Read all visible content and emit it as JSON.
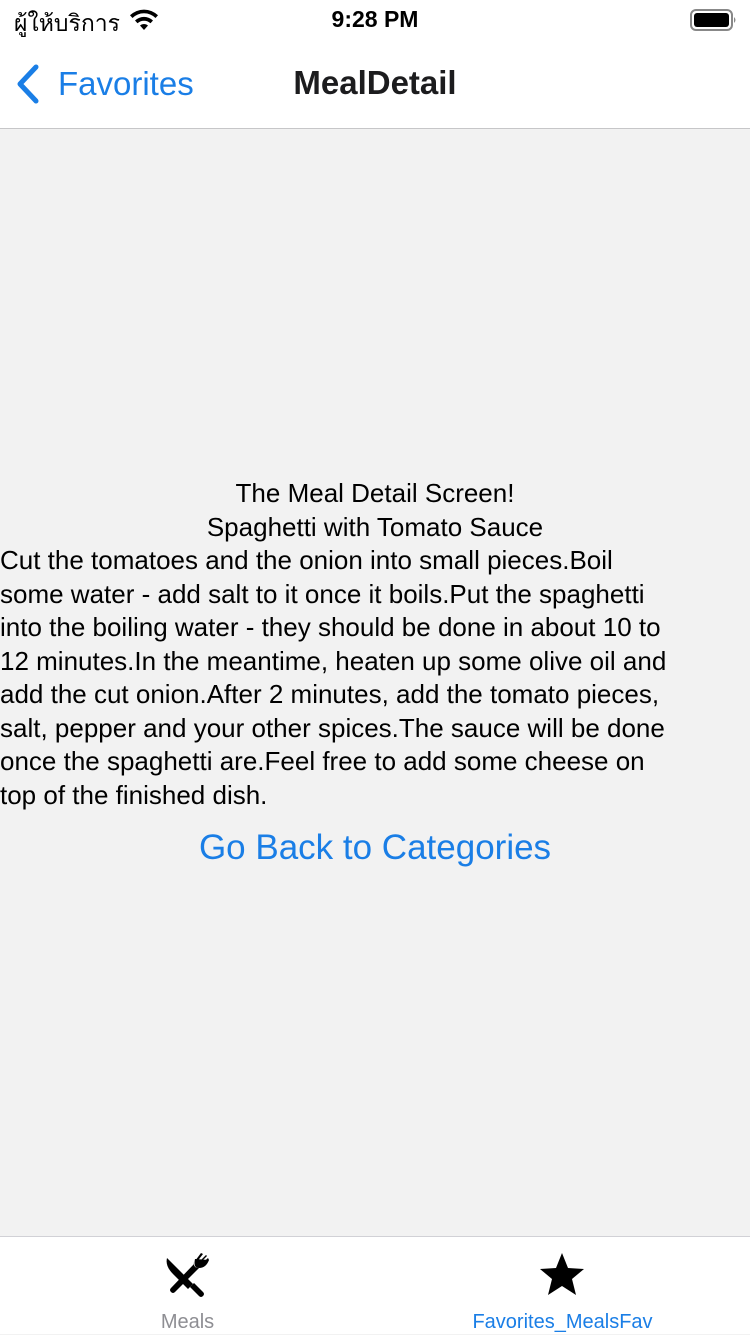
{
  "status_bar": {
    "carrier": "ผู้ให้บริการ",
    "time": "9:28 PM"
  },
  "nav": {
    "back_label": "Favorites",
    "title": "MealDetail"
  },
  "content": {
    "heading": "The Meal Detail Screen!",
    "meal_title": "Spaghetti with Tomato Sauce",
    "steps": "Cut the tomatoes and the onion into small pieces.Boil\nsome water - add salt to it once it boils.Put the spaghetti\ninto the boiling water - they should be done in about 10 to\n12 minutes.In the meantime, heaten up some olive oil and\nadd the cut onion.After 2 minutes, add the tomato pieces,\nsalt, pepper and your other spices.The sauce will be done\nonce the spaghetti are.Feel free to add some cheese on\ntop of the finished dish.",
    "go_back_label": "Go Back to Categories"
  },
  "tab_bar": {
    "tabs": [
      {
        "label": "Meals",
        "icon": "utensils-icon",
        "active": false
      },
      {
        "label": "Favorites_MealsFav",
        "icon": "star-icon",
        "active": true
      }
    ]
  },
  "colors": {
    "accent": "#1a7ee6",
    "inactive": "#8e8e93",
    "background": "#f2f2f2"
  }
}
